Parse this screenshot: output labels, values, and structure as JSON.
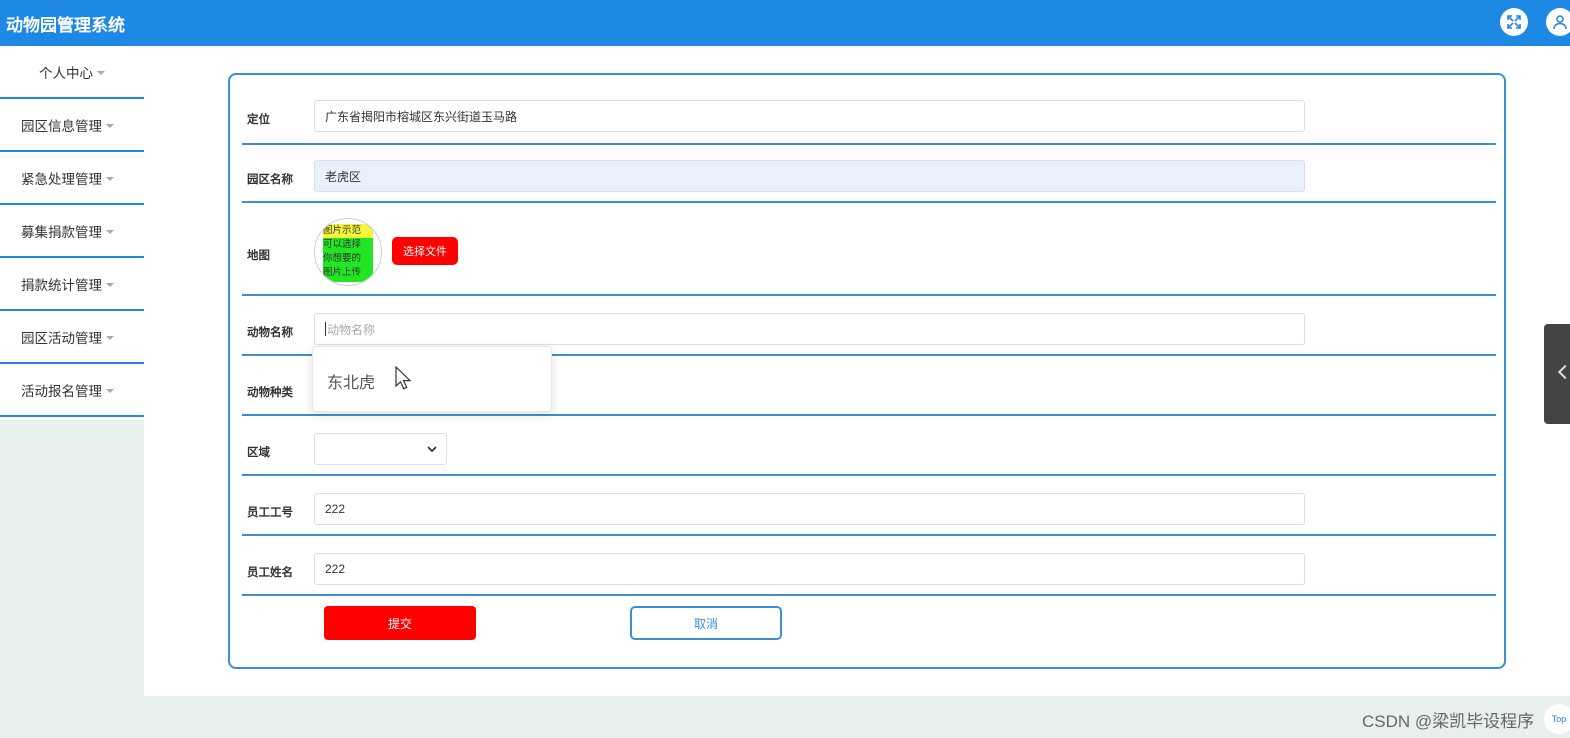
{
  "app": {
    "title": "动物园管理系统"
  },
  "sidebar": {
    "items": [
      {
        "label": "个人中心"
      },
      {
        "label": "园区信息管理"
      },
      {
        "label": "紧急处理管理"
      },
      {
        "label": "募集捐款管理"
      },
      {
        "label": "捐款统计管理"
      },
      {
        "label": "园区活动管理"
      },
      {
        "label": "活动报名管理"
      }
    ]
  },
  "form": {
    "location": {
      "label": "定位",
      "value": "广东省揭阳市榕城区东兴街道玉马路"
    },
    "zone_name": {
      "label": "园区名称",
      "value": "老虎区"
    },
    "map": {
      "label": "地图",
      "sample_text": [
        "图片示范",
        "可以选择",
        "你想要的",
        "图片上传"
      ],
      "button": "选择文件"
    },
    "animal_name": {
      "label": "动物名称",
      "placeholder": "动物名称"
    },
    "animal_type": {
      "label": "动物种类"
    },
    "area": {
      "label": "区域",
      "value": ""
    },
    "staff_id": {
      "label": "员工工号",
      "value": "222"
    },
    "staff_name": {
      "label": "员工姓名",
      "value": "222"
    },
    "submit": "提交",
    "cancel": "取消"
  },
  "autocomplete": {
    "options": [
      "东北虎"
    ]
  },
  "widgets": {
    "top_label": "Top"
  },
  "watermark": "CSDN @梁凯毕设程序",
  "colors": {
    "header": "#1e88e5",
    "accent_border": "#3b8fd8",
    "primary_button": "#ff0000"
  }
}
